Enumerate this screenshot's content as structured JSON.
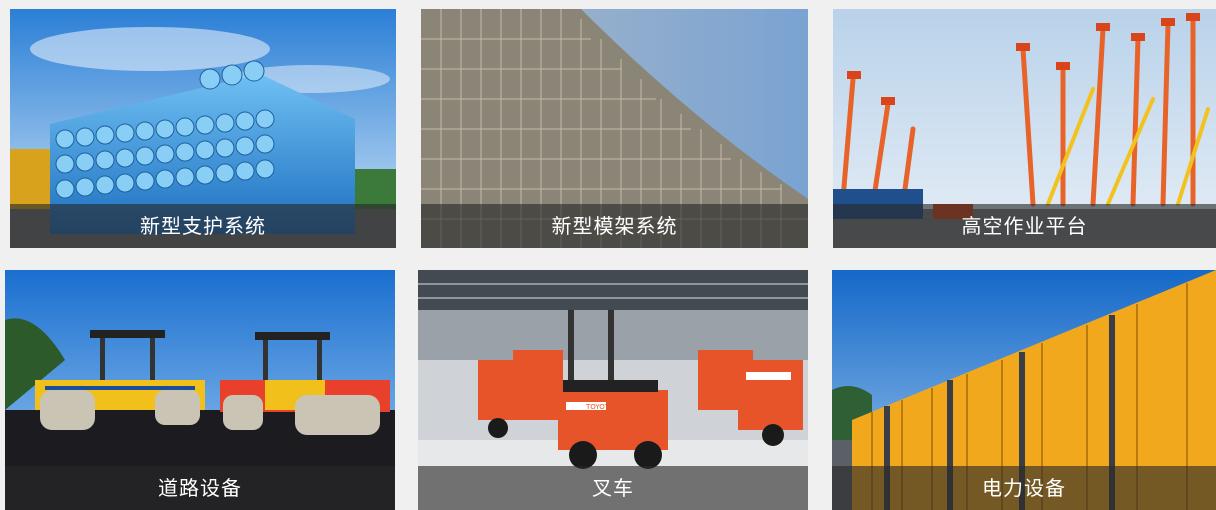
{
  "products": [
    {
      "id": "support-system",
      "label": "新型支护系统"
    },
    {
      "id": "formwork-system",
      "label": "新型模架系统"
    },
    {
      "id": "aerial-platform",
      "label": "高空作业平台"
    },
    {
      "id": "road-equipment",
      "label": "道路设备"
    },
    {
      "id": "forklift",
      "label": "叉车"
    },
    {
      "id": "power-equipment",
      "label": "电力设备"
    }
  ],
  "forklift_brand": "TOYOTA",
  "colors": {
    "caption_bg": "#3a3a3a",
    "caption_text": "#ffffff",
    "pipe_blue": "#2f8fd8",
    "forklift_orange": "#e8542a",
    "lift_orange": "#e8632a",
    "roller_yellow": "#f1c01a",
    "generator_yellow": "#f2a81d"
  }
}
